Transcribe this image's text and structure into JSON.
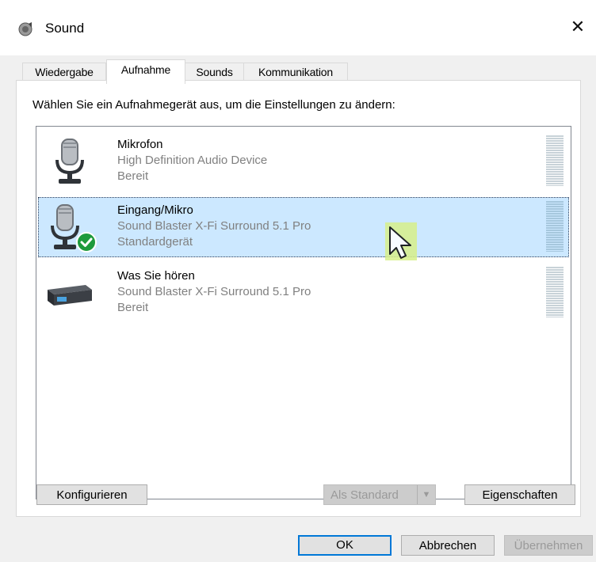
{
  "window": {
    "title": "Sound"
  },
  "tabs": [
    "Wiedergabe",
    "Aufnahme",
    "Sounds",
    "Kommunikation"
  ],
  "instruction": "Wählen Sie ein Aufnahmegerät aus, um die Einstellungen zu ändern:",
  "devices": [
    {
      "name": "Mikrofon",
      "driver": "High Definition Audio Device",
      "status": "Bereit",
      "icon": "microphone-icon"
    },
    {
      "name": "Eingang/Mikro",
      "driver": "Sound Blaster X-Fi Surround 5.1 Pro",
      "status": "Standardgerät",
      "icon": "microphone-icon",
      "selected": true
    },
    {
      "name": "Was Sie hören",
      "driver": "Sound Blaster X-Fi Surround 5.1 Pro",
      "status": "Bereit",
      "icon": "sound-device-icon"
    }
  ],
  "buttons": {
    "configure": "Konfigurieren",
    "set_default": "Als Standard",
    "properties": "Eigenschaften",
    "ok": "OK",
    "cancel": "Abbrechen",
    "apply": "Übernehmen"
  },
  "colors": {
    "selection": "#cce8ff",
    "accent": "#0078d7",
    "check": "#1e9a3c"
  }
}
